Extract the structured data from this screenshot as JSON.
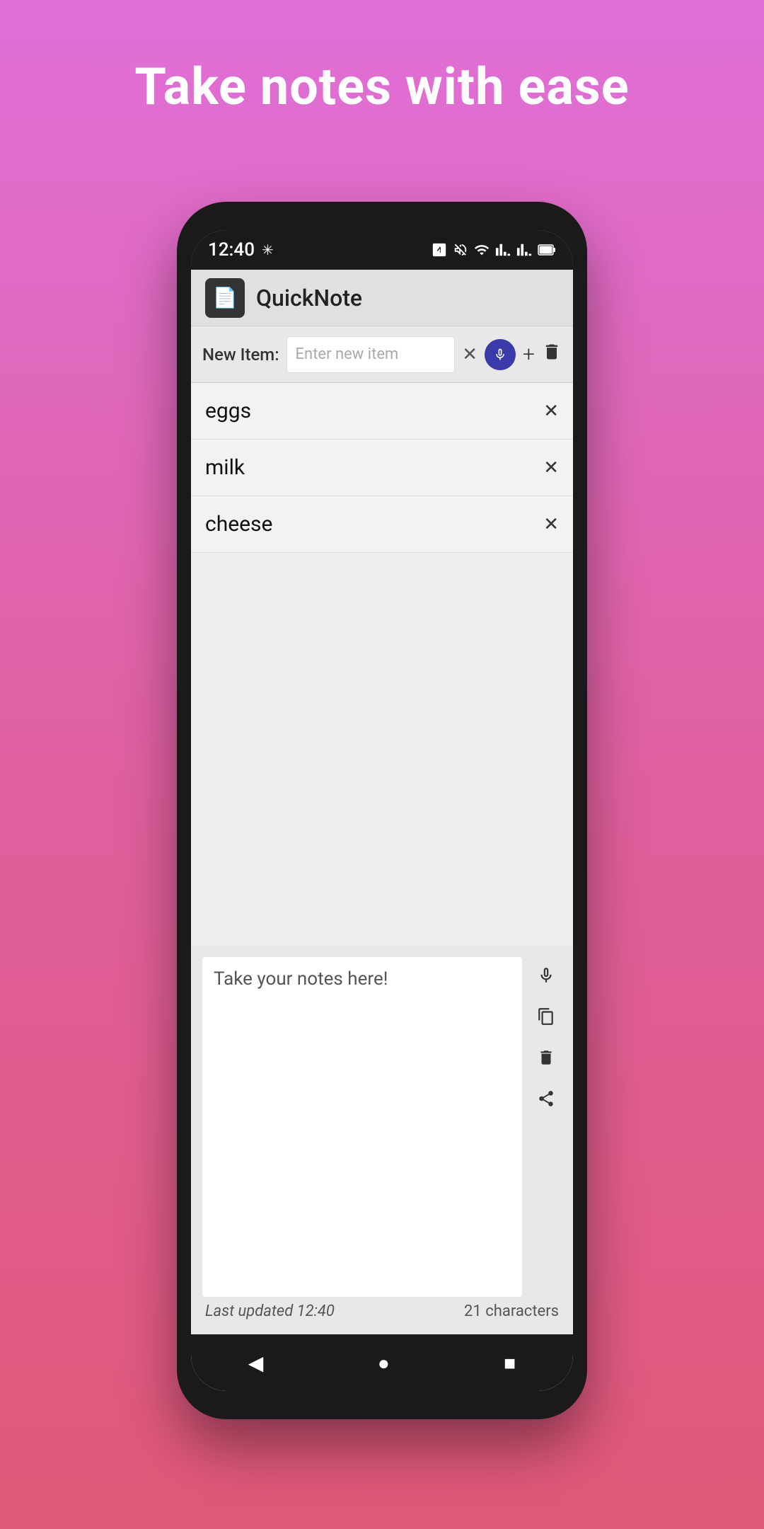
{
  "header": {
    "title": "Take notes with ease"
  },
  "statusBar": {
    "time": "12:40",
    "icons": [
      "nfc",
      "mute",
      "wifi",
      "signal1",
      "signal2",
      "battery"
    ]
  },
  "appBar": {
    "appName": "QuickNote"
  },
  "inputRow": {
    "label": "New Item:",
    "placeholder": "Enter new item"
  },
  "listItems": [
    {
      "text": "eggs"
    },
    {
      "text": "milk"
    },
    {
      "text": "cheese"
    }
  ],
  "notesArea": {
    "placeholder": "Take your notes here!",
    "footerLeft": "Last updated 12:40",
    "footerRight": "21 characters"
  },
  "navBar": {
    "backLabel": "◀",
    "homeLabel": "●",
    "recentLabel": "■"
  }
}
